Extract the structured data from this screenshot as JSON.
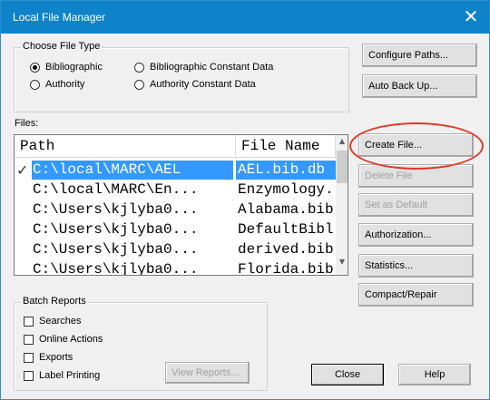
{
  "window": {
    "title": "Local File Manager",
    "close_glyph": "✕"
  },
  "choose_file_type": {
    "legend": "Choose File Type",
    "options": [
      {
        "label": "Bibliographic",
        "checked": true
      },
      {
        "label": "Bibliographic Constant Data",
        "checked": false
      },
      {
        "label": "Authority",
        "checked": false
      },
      {
        "label": "Authority Constant Data",
        "checked": false
      }
    ]
  },
  "files_label": "Files:",
  "file_list": {
    "columns": [
      "Path",
      "File Name"
    ],
    "rows": [
      {
        "path": "C:\\local\\MARC\\AEL",
        "file": "AEL.bib.db",
        "selected": true,
        "default_mark": "✓"
      },
      {
        "path": "C:\\local\\MARC\\En...",
        "file": "Enzymology.",
        "selected": false
      },
      {
        "path": "C:\\Users\\kjlyba0...",
        "file": "Alabama.bib",
        "selected": false
      },
      {
        "path": "C:\\Users\\kjlyba0...",
        "file": "DefaultBibl",
        "selected": false
      },
      {
        "path": "C:\\Users\\kjlyba0...",
        "file": "derived.bib",
        "selected": false
      },
      {
        "path": "C:\\Users\\kjlyba0...",
        "file": "Florida.bib",
        "selected": false
      }
    ],
    "scroll_up": "▲",
    "scroll_down": "▼"
  },
  "buttons": {
    "configure_paths": "Configure Paths...",
    "auto_back_up": "Auto Back Up...",
    "create_file": "Create File...",
    "delete_file": "Delete File",
    "set_as_default": "Set as Default",
    "authorization": "Authorization...",
    "statistics": "Statistics...",
    "compact_repair": "Compact/Repair",
    "view_reports": "View Reports...",
    "close": "Close",
    "help": "Help"
  },
  "batch_reports": {
    "legend": "Batch Reports",
    "items": [
      "Searches",
      "Online Actions",
      "Exports",
      "Label Printing"
    ]
  },
  "colors": {
    "titlebar": "#0e83c9",
    "selection": "#3399ff",
    "annotation": "#e0392b"
  }
}
